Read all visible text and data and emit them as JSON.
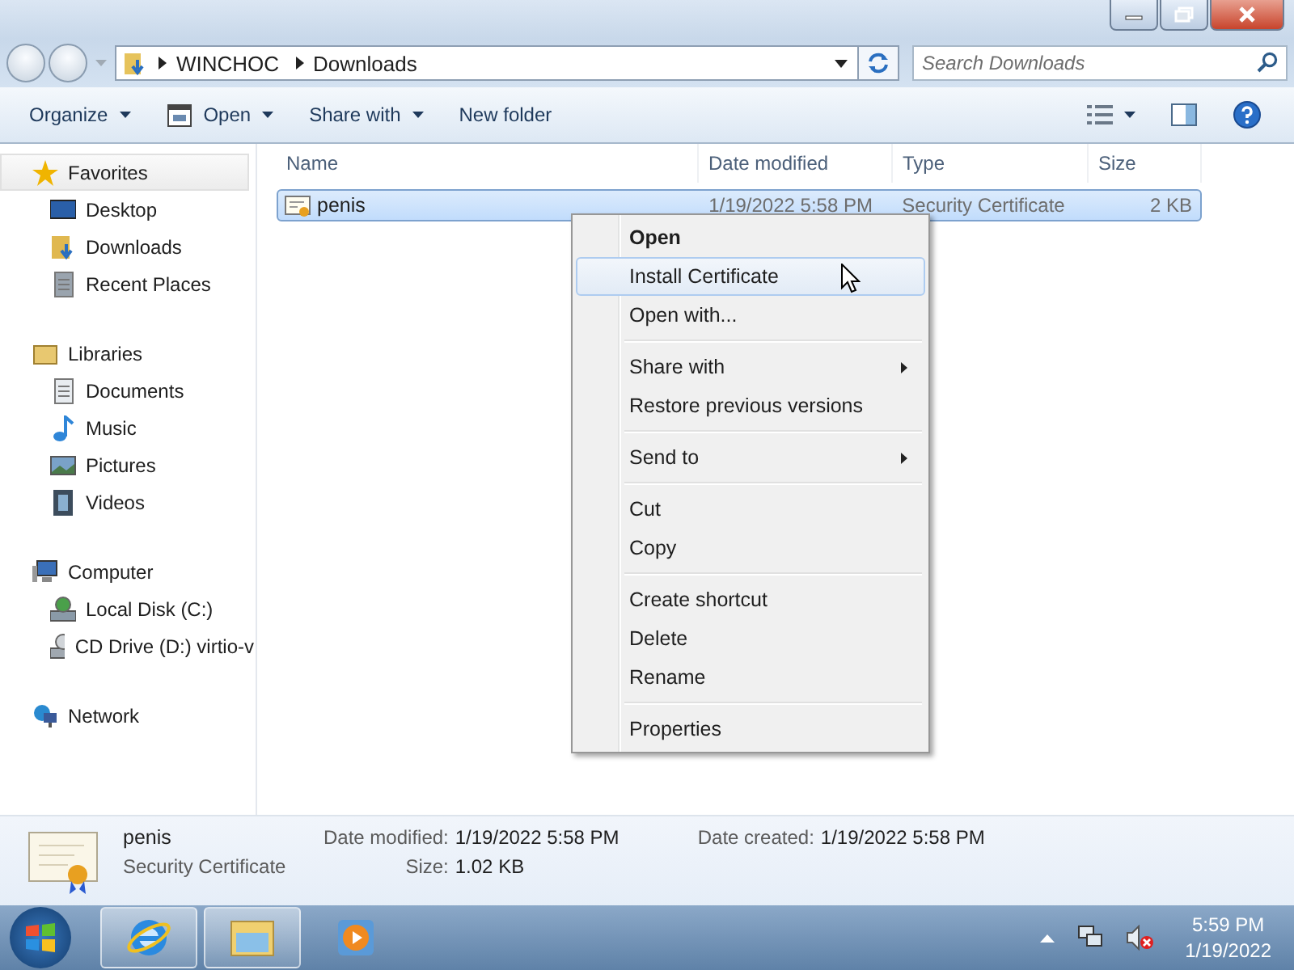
{
  "address": {
    "path": [
      "WINCHOC",
      "Downloads"
    ]
  },
  "search": {
    "placeholder": "Search Downloads"
  },
  "toolbar": [
    {
      "label": "Organize",
      "kind": "plain",
      "dropdown": true
    },
    {
      "label": "Open",
      "kind": "open",
      "dropdown": true
    },
    {
      "label": "Share with",
      "kind": "plain",
      "dropdown": true
    },
    {
      "label": "New folder",
      "kind": "plain",
      "dropdown": false
    }
  ],
  "sidebar": [
    {
      "label": "Favorites",
      "kind": "star",
      "selected": true,
      "children": [
        {
          "label": "Desktop",
          "kind": "desktop",
          "selected": false
        },
        {
          "label": "Downloads",
          "kind": "downloads",
          "selected": false
        },
        {
          "label": "Recent Places",
          "kind": "recent",
          "selected": false
        }
      ]
    },
    {
      "label": "Libraries",
      "kind": "libraries",
      "selected": false,
      "children": [
        {
          "label": "Documents",
          "kind": "documents",
          "selected": false
        },
        {
          "label": "Music",
          "kind": "music",
          "selected": false
        },
        {
          "label": "Pictures",
          "kind": "pictures",
          "selected": false
        },
        {
          "label": "Videos",
          "kind": "videos",
          "selected": false
        }
      ]
    },
    {
      "label": "Computer",
      "kind": "computer",
      "selected": false,
      "children": [
        {
          "label": "Local Disk (C:)",
          "kind": "disk",
          "selected": false
        },
        {
          "label": "CD Drive (D:) virtio-v",
          "kind": "cd",
          "selected": false
        }
      ]
    },
    {
      "label": "Network",
      "kind": "network",
      "selected": false
    }
  ],
  "columns": [
    "Name",
    "Date modified",
    "Type",
    "Size"
  ],
  "files": [
    {
      "name": "penis",
      "date": "1/19/2022 5:58 PM",
      "type": "Security Certificate",
      "size": "2 KB",
      "selected": true
    }
  ],
  "context_menu": [
    {
      "kind": "item",
      "label": "Open",
      "bold": true,
      "highlighted": false,
      "submenu": false
    },
    {
      "kind": "item",
      "label": "Install Certificate",
      "bold": false,
      "highlighted": true,
      "submenu": false
    },
    {
      "kind": "item",
      "label": "Open with...",
      "bold": false,
      "highlighted": false,
      "submenu": false
    },
    {
      "kind": "separator"
    },
    {
      "kind": "item",
      "label": "Share with",
      "bold": false,
      "highlighted": false,
      "submenu": true
    },
    {
      "kind": "item",
      "label": "Restore previous versions",
      "bold": false,
      "highlighted": false,
      "submenu": false
    },
    {
      "kind": "separator"
    },
    {
      "kind": "item",
      "label": "Send to",
      "bold": false,
      "highlighted": false,
      "submenu": true
    },
    {
      "kind": "separator"
    },
    {
      "kind": "item",
      "label": "Cut",
      "bold": false,
      "highlighted": false,
      "submenu": false
    },
    {
      "kind": "item",
      "label": "Copy",
      "bold": false,
      "highlighted": false,
      "submenu": false
    },
    {
      "kind": "separator"
    },
    {
      "kind": "item",
      "label": "Create shortcut",
      "bold": false,
      "highlighted": false,
      "submenu": false
    },
    {
      "kind": "item",
      "label": "Delete",
      "bold": false,
      "highlighted": false,
      "submenu": false
    },
    {
      "kind": "item",
      "label": "Rename",
      "bold": false,
      "highlighted": false,
      "submenu": false
    },
    {
      "kind": "separator"
    },
    {
      "kind": "item",
      "label": "Properties",
      "bold": false,
      "highlighted": false,
      "submenu": false
    }
  ],
  "details": {
    "name": "penis",
    "type": "Security Certificate",
    "columns": [
      [
        {
          "label": "Date modified:",
          "value": "1/19/2022 5:58 PM"
        },
        {
          "label": "Size:",
          "value": "1.02 KB"
        }
      ],
      [
        {
          "label": "Date created:",
          "value": "1/19/2022 5:58 PM"
        }
      ]
    ]
  },
  "taskbar": {
    "apps": [
      {
        "kind": "browser",
        "running": true
      },
      {
        "kind": "folder",
        "running": true
      },
      {
        "kind": "media",
        "running": false
      }
    ],
    "time": "5:59 PM",
    "date": "1/19/2022"
  }
}
